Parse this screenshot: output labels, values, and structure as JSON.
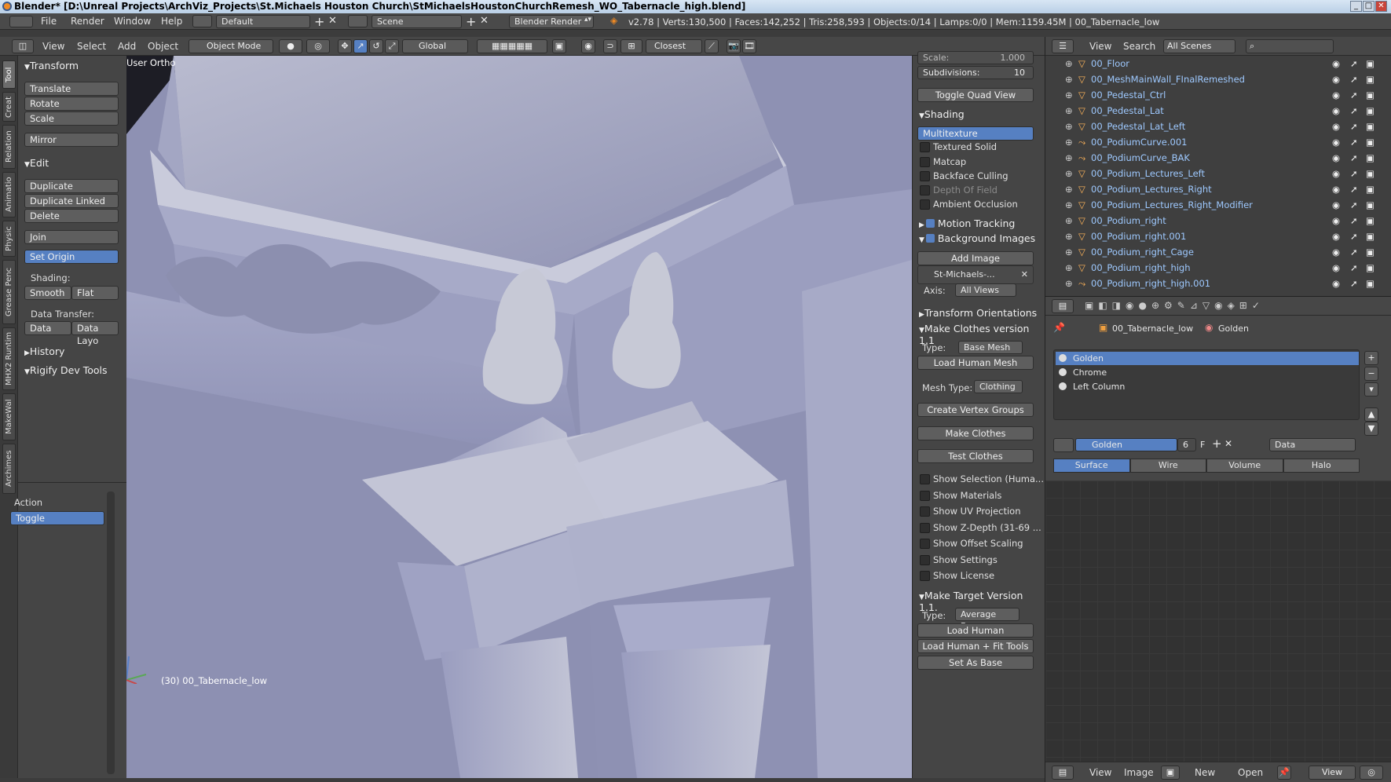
{
  "title": "Blender* [D:\\Unreal Projects\\ArchViz_Projects\\St.Michaels Houston Church\\StMichaelsHoustonChurchRemesh_WO_Tabernacle_high.blend]",
  "menu": [
    "File",
    "Render",
    "Window",
    "Help"
  ],
  "screen_layout": "Default",
  "scene": "Scene",
  "render_engine": "Blender Render",
  "stats": "v2.78 | Verts:130,500 | Faces:142,252 | Tris:258,593 | Objects:0/14 | Lamps:0/0 | Mem:1159.45M | 00_Tabernacle_low",
  "header3d": {
    "view": "View",
    "select": "Select",
    "add": "Add",
    "object": "Object",
    "mode": "Object Mode",
    "orientation": "Global",
    "snap": "Closest"
  },
  "tabs": [
    "Tool",
    "Creat",
    "Relation",
    "Animatio",
    "Physic",
    "Grease Penc",
    "MHX2 Runtim",
    "MakeWal",
    "Archimes"
  ],
  "toolshelf": {
    "transform": "Transform",
    "translate": "Translate",
    "rotate": "Rotate",
    "scale": "Scale",
    "mirror": "Mirror",
    "edit": "Edit",
    "duplicate": "Duplicate",
    "duplicate_linked": "Duplicate Linked",
    "delete": "Delete",
    "join": "Join",
    "set_origin": "Set Origin",
    "shading": "Shading:",
    "smooth": "Smooth",
    "flat": "Flat",
    "data_transfer": "Data Transfer:",
    "data": "Data",
    "data_layo": "Data Layo",
    "history": "History",
    "rigify": "Rigify Dev Tools",
    "action": "Action",
    "toggle": "Toggle"
  },
  "viewport": {
    "view_label": "User Ortho",
    "object_label": "(30) 00_Tabernacle_low"
  },
  "npanel": {
    "scale_label": "Scale:",
    "scale_val": "1.000",
    "subdiv_label": "Subdivisions:",
    "subdiv_val": "10",
    "toggle_quad": "Toggle Quad View",
    "shading": "Shading",
    "multitexture": "Multitexture",
    "textured_solid": "Textured Solid",
    "matcap": "Matcap",
    "backface": "Backface Culling",
    "dof": "Depth Of Field",
    "ao": "Ambient Occlusion",
    "motion": "Motion Tracking",
    "bgimages": "Background Images",
    "add_image": "Add Image",
    "stmichaels": "St-Michaels-...",
    "axis": "Axis:",
    "all_views": "All Views",
    "transform_orient": "Transform Orientations",
    "make_clothes": "Make Clothes version 1.1",
    "type": "Type:",
    "base_mesh": "Base Mesh",
    "load_human_mesh": "Load Human Mesh",
    "mesh_type": "Mesh Type:",
    "clothing": "Clothing",
    "create_vg": "Create Vertex Groups",
    "make_clothes_btn": "Make Clothes",
    "test_clothes": "Test Clothes",
    "show_sel": "Show Selection (Huma...",
    "show_mat": "Show Materials",
    "show_uv": "Show UV Projection",
    "show_z": "Show Z-Depth (31-69 ...",
    "show_offset": "Show Offset Scaling",
    "show_settings": "Show Settings",
    "show_license": "Show License",
    "make_target": "Make Target  Version 1.1.",
    "avg_fem": "Average Fem...",
    "load_human": "Load Human",
    "load_fit": "Load Human + Fit Tools",
    "set_base": "Set As Base"
  },
  "outliner": {
    "view": "View",
    "search": "Search",
    "scenes": "All Scenes",
    "items": [
      "00_Floor",
      "00_MeshMainWall_FInalRemeshed",
      "00_Pedestal_Ctrl",
      "00_Pedestal_Lat",
      "00_Pedestal_Lat_Left",
      "00_PodiumCurve.001",
      "00_PodiumCurve_BAK",
      "00_Podium_Lectures_Left",
      "00_Podium_Lectures_Right",
      "00_Podium_Lectures_Right_Modifier",
      "00_Podium_right",
      "00_Podium_right.001",
      "00_Podium_right_Cage",
      "00_Podium_right_high",
      "00_Podium_right_high.001"
    ]
  },
  "props": {
    "object": "00_Tabernacle_low",
    "material": "Golden",
    "slots": [
      "Golden",
      "Chrome",
      "Left Column"
    ],
    "mat_field": "Golden",
    "users": "6",
    "f": "F",
    "data": "Data",
    "tabs": [
      "Surface",
      "Wire",
      "Volume",
      "Halo"
    ]
  },
  "imgeditor": {
    "view": "View",
    "image": "Image",
    "new": "New",
    "open": "Open",
    "view2": "View"
  },
  "colors": {
    "accent": "#5680c2",
    "checkbox_on": "#5680c2",
    "link_text": "#9ec9ff"
  }
}
